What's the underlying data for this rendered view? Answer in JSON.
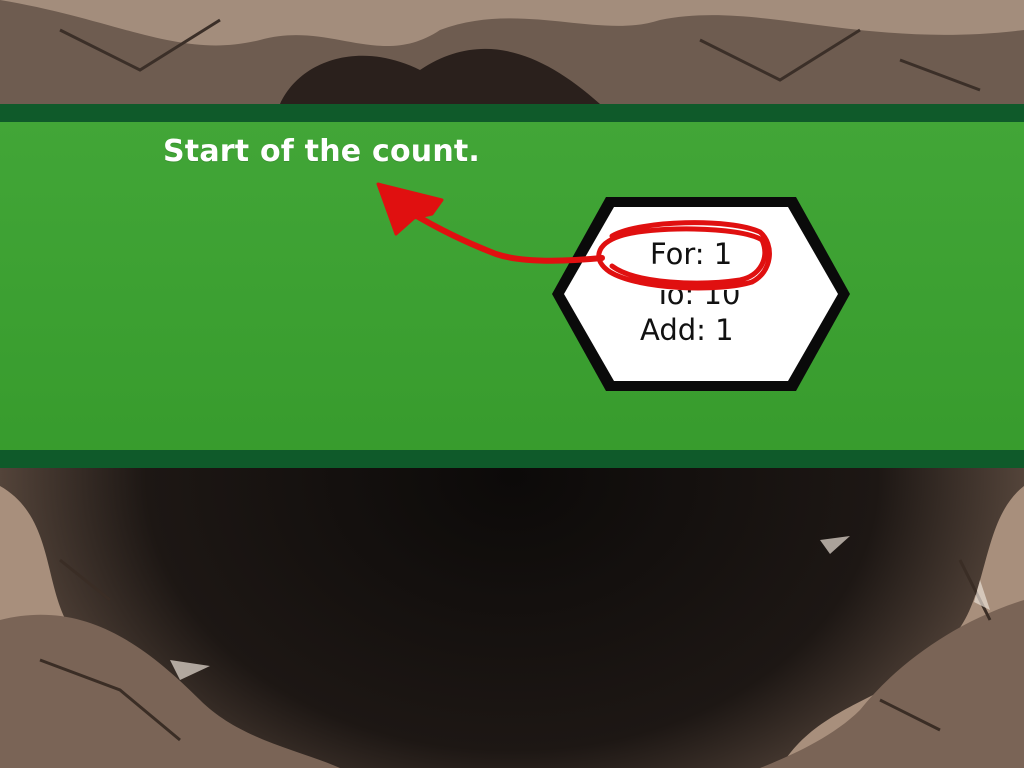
{
  "dialog": {
    "message": "Start of the count."
  },
  "loop_block": {
    "for_label": "For: 1",
    "to_label": "To:  10",
    "add_label": "Add: 1"
  },
  "annotation": {
    "circled_item": "For: 1",
    "color": "#e01010"
  },
  "colors": {
    "banner_green": "#3aa22f",
    "banner_border": "#0f5a2a",
    "hex_fill": "#ffffff",
    "hex_outline": "#0a0a0a"
  }
}
